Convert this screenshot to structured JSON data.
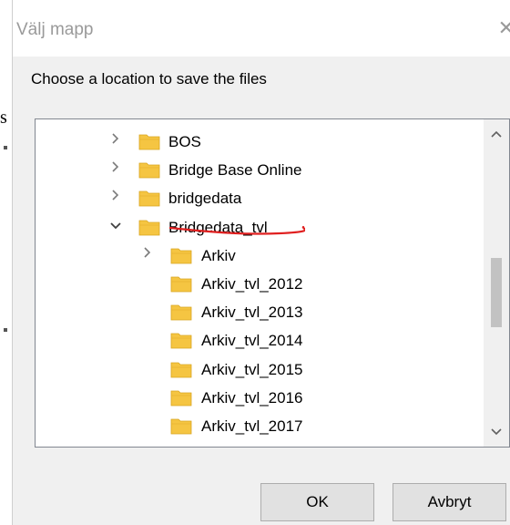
{
  "window": {
    "title": "Välj mapp"
  },
  "prompt": "Choose a location to save the files",
  "background_fragment": "s",
  "tree": {
    "items": [
      {
        "label": "BOS",
        "expander": "collapsed",
        "level": 0
      },
      {
        "label": "Bridge Base Online",
        "expander": "collapsed",
        "level": 0
      },
      {
        "label": "bridgedata",
        "expander": "collapsed",
        "level": 0
      },
      {
        "label": "Bridgedata_tvl",
        "expander": "expanded",
        "level": 0,
        "annotated": true
      },
      {
        "label": "Arkiv",
        "expander": "collapsed",
        "level": 1
      },
      {
        "label": "Arkiv_tvl_2012",
        "expander": "none",
        "level": 1
      },
      {
        "label": "Arkiv_tvl_2013",
        "expander": "none",
        "level": 1
      },
      {
        "label": "Arkiv_tvl_2014",
        "expander": "none",
        "level": 1
      },
      {
        "label": "Arkiv_tvl_2015",
        "expander": "none",
        "level": 1
      },
      {
        "label": "Arkiv_tvl_2016",
        "expander": "none",
        "level": 1
      },
      {
        "label": "Arkiv_tvl_2017",
        "expander": "none",
        "level": 1
      }
    ]
  },
  "buttons": {
    "ok": "OK",
    "cancel": "Avbryt"
  },
  "icons": {
    "close": "close-icon",
    "folder": "folder-icon",
    "expand": "chevron-right-icon",
    "collapse": "chevron-down-icon",
    "scroll_up": "scroll-up-icon",
    "scroll_down": "scroll-down-icon"
  },
  "colors": {
    "folder": "#f5c542",
    "annotation": "#e02020",
    "title_text": "#9a9a9a"
  }
}
